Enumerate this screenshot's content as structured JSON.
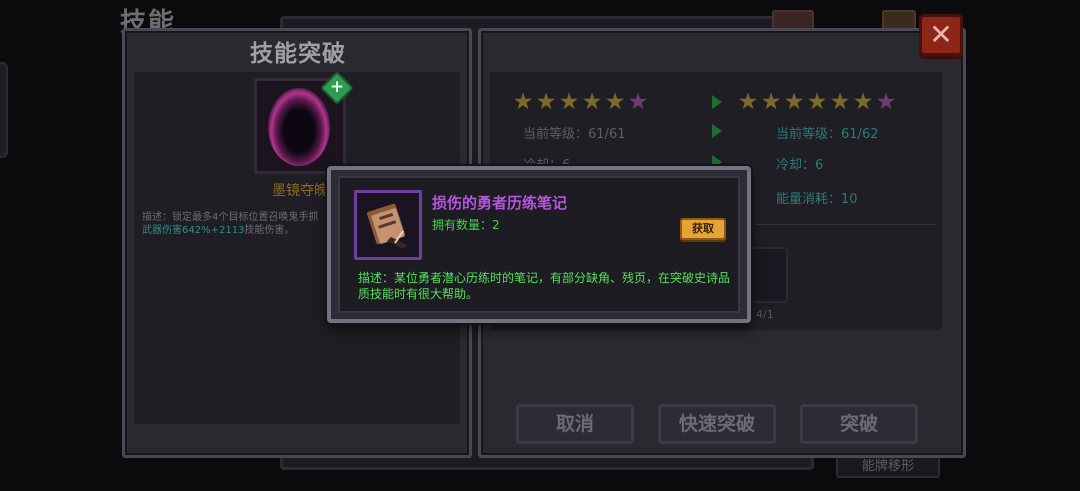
{
  "background": {
    "title": "技能",
    "bottom_right_label": "能牌移形"
  },
  "left_panel": {
    "title": "技能突破",
    "skill_name": "墨镜夺魄",
    "desc_prefix": "描述：锁定最多4个目标位置召唤鬼手抓",
    "desc_accent": "武器伤害642%+2113",
    "desc_suffix": "技能伤害。"
  },
  "right_panel": {
    "current": {
      "stars_gold": 5,
      "stars_purple": 1,
      "level_label": "当前等级：",
      "level_value": "61/61",
      "cooldown_label": "冷却：",
      "cooldown_value": "6"
    },
    "next": {
      "stars_gold": 6,
      "stars_purple": 1,
      "level_label": "当前等级：",
      "level_value": "61/62",
      "cooldown_label": "冷却：",
      "cooldown_value": "6",
      "energy_label": "能量消耗：",
      "energy_value": "10"
    },
    "cost_count": "4/1",
    "buttons": {
      "cancel": "取消",
      "quick_break": "快速突破",
      "break": "突破"
    }
  },
  "close_button": "✕",
  "tooltip": {
    "item_name": "损伤的勇者历练笔记",
    "owned_label": "拥有数量：",
    "owned_value": "2",
    "get_button": "获取",
    "description": "描述：某位勇者潜心历练时的笔记，有部分缺角、残页，在突破史诗品质技能时有很大帮助。"
  },
  "icons": {
    "close": "close-icon",
    "plus": "plus-icon",
    "star": "star-icon",
    "arrow": "arrow-right-icon",
    "item": "notebook-icon"
  },
  "colors": {
    "item_rarity": "#b456dc",
    "owned_green": "#43d44a",
    "get_button": "#e7a436",
    "close_red": "#8e2519"
  }
}
